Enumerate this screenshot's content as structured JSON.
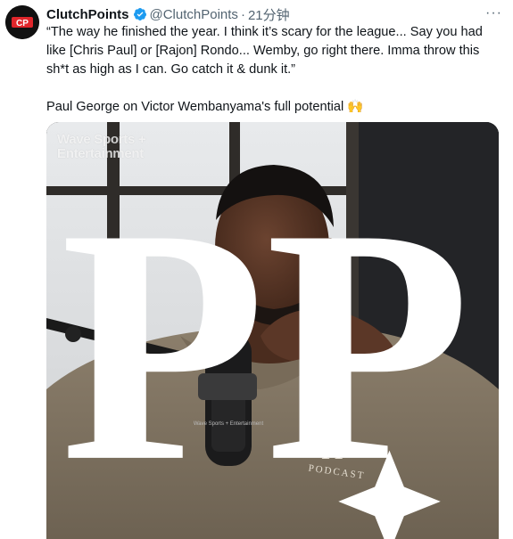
{
  "tweet": {
    "author_name": "ClutchPoints",
    "handle": "@ClutchPoints",
    "separator": "·",
    "timestamp": "21分钟",
    "more_label": "···",
    "avatar_text": "CP",
    "text_quote": "“The way he finished the year. I think it’s scary for the league... Say you had like [Chris Paul] or [Rajon] Rondo... Wemby, go right there. Imma throw this sh*t as high as I can. Go catch it & dunk it.”",
    "text_caption": "Paul George on Victor Wembanyama's full potential 🙌"
  },
  "media": {
    "watermark_line1": "Wave Sports +",
    "watermark_line2": "Entertainment",
    "logo_text": "PP",
    "mic_label": "Wave Sports + Entertainment",
    "hoodie_text": "PODCAST"
  },
  "colors": {
    "verified_blue": "#1d9bf0",
    "avatar_red": "#e0262b",
    "hoodie": "#857866"
  }
}
